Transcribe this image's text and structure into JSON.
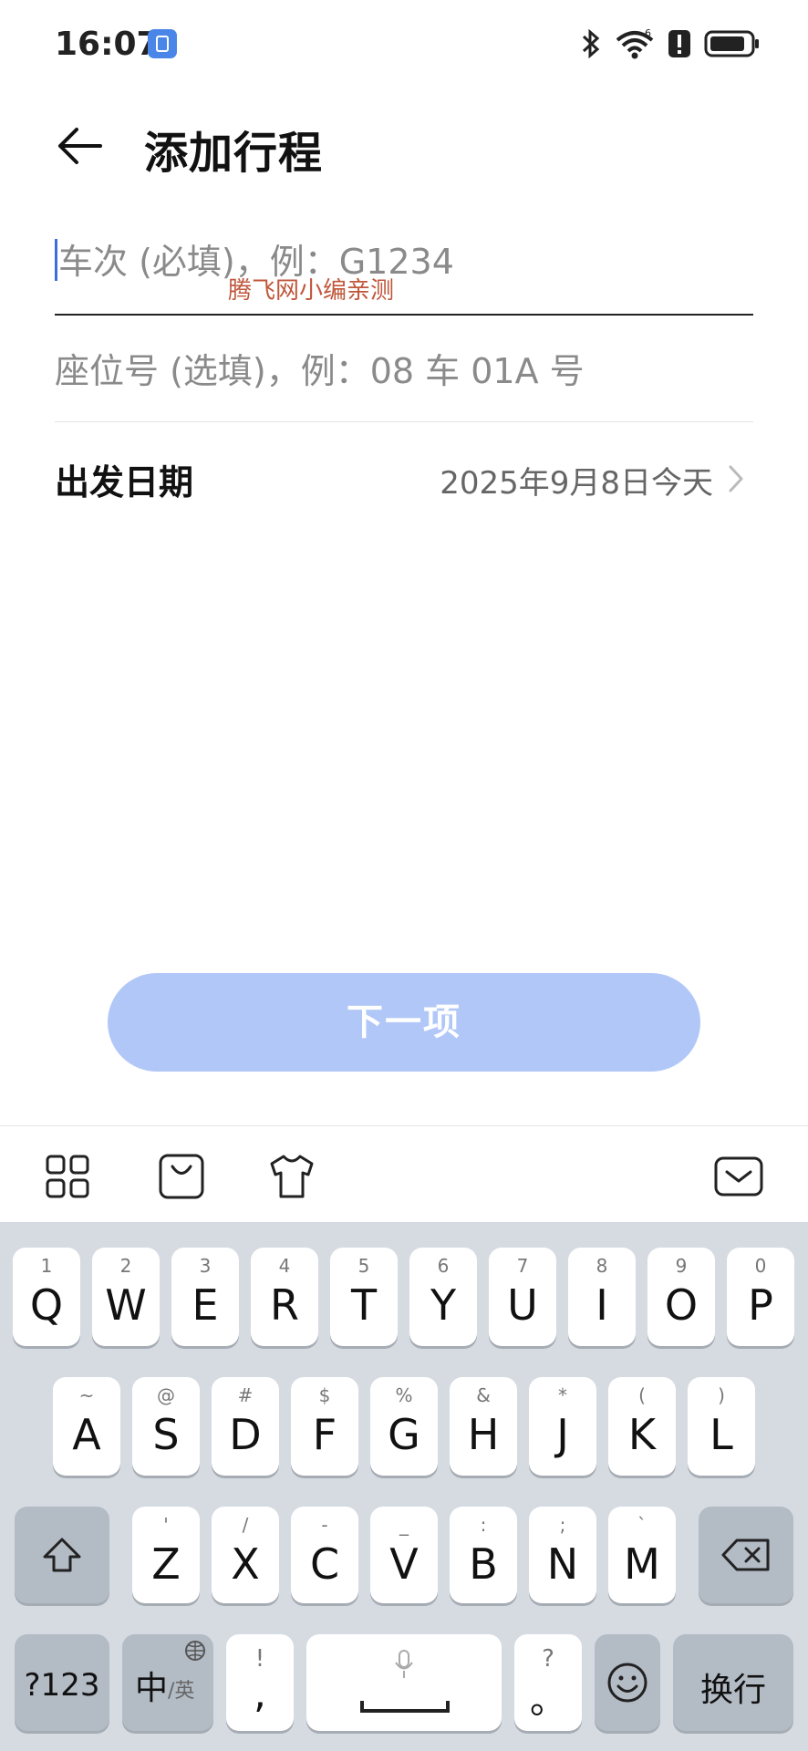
{
  "status_bar": {
    "time": "16:07",
    "bluetooth_icon": "bluetooth-icon",
    "wifi_icon": "wifi-6-icon",
    "alert_icon": "alert-icon",
    "battery_icon": "battery-icon"
  },
  "header": {
    "title": "添加行程"
  },
  "form": {
    "train_placeholder": "车次 (必填)，例：G1234",
    "watermark": "腾飞网小编亲测",
    "seat_placeholder": "座位号 (选填)，例：08 车 01A 号",
    "date_label": "出发日期",
    "date_value": "2025年9月8日今天"
  },
  "next_button": {
    "label": "下一项"
  },
  "keyboard": {
    "row1": [
      {
        "sub": "1",
        "main": "Q"
      },
      {
        "sub": "2",
        "main": "W"
      },
      {
        "sub": "3",
        "main": "E"
      },
      {
        "sub": "4",
        "main": "R"
      },
      {
        "sub": "5",
        "main": "T"
      },
      {
        "sub": "6",
        "main": "Y"
      },
      {
        "sub": "7",
        "main": "U"
      },
      {
        "sub": "8",
        "main": "I"
      },
      {
        "sub": "9",
        "main": "O"
      },
      {
        "sub": "0",
        "main": "P"
      }
    ],
    "row2": [
      {
        "sub": "~",
        "main": "A"
      },
      {
        "sub": "@",
        "main": "S"
      },
      {
        "sub": "#",
        "main": "D"
      },
      {
        "sub": "$",
        "main": "F"
      },
      {
        "sub": "%",
        "main": "G"
      },
      {
        "sub": "&",
        "main": "H"
      },
      {
        "sub": "*",
        "main": "J"
      },
      {
        "sub": "(",
        "main": "K"
      },
      {
        "sub": ")",
        "main": "L"
      }
    ],
    "row3": [
      {
        "sub": "'",
        "main": "Z"
      },
      {
        "sub": "/",
        "main": "X"
      },
      {
        "sub": "-",
        "main": "C"
      },
      {
        "sub": "_",
        "main": "V"
      },
      {
        "sub": ":",
        "main": "B"
      },
      {
        "sub": ";",
        "main": "N"
      },
      {
        "sub": "`",
        "main": "M"
      }
    ],
    "num_key": "?123",
    "lang_key_main": "中",
    "lang_key_sub": "/英",
    "comma_sub": "!",
    "comma_main": ",",
    "period_sub": "?",
    "period_main": "。",
    "enter_key": "换行"
  }
}
